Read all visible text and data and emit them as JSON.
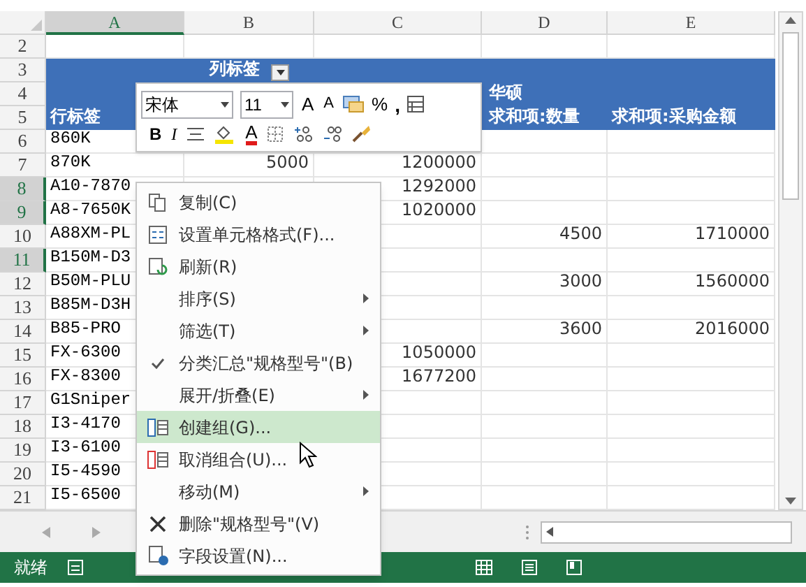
{
  "columns": [
    "A",
    "B",
    "C",
    "D",
    "E"
  ],
  "rows": [
    {
      "num": "2",
      "selected": false,
      "kind": "blank",
      "cells": [
        "",
        "",
        "",
        "",
        ""
      ]
    },
    {
      "num": "3",
      "selected": false,
      "kind": "pivot-header",
      "cells": [
        "",
        "列标签",
        "",
        "",
        ""
      ],
      "dropdown": true
    },
    {
      "num": "4",
      "selected": false,
      "kind": "pivot-header",
      "cells": [
        "",
        "",
        "",
        "华硕",
        ""
      ]
    },
    {
      "num": "5",
      "selected": false,
      "kind": "pivot-header",
      "cells": [
        "行标签",
        "",
        "",
        "求和项:数量",
        "求和项:采购金额"
      ]
    },
    {
      "num": "6",
      "selected": false,
      "kind": "data",
      "cells": [
        "860K",
        "",
        "",
        "",
        ""
      ]
    },
    {
      "num": "7",
      "selected": false,
      "kind": "data",
      "cells": [
        "870K",
        "5000",
        "1200000",
        "",
        ""
      ]
    },
    {
      "num": "8",
      "selected": true,
      "kind": "data",
      "cells": [
        "A10-7870",
        "",
        "1292000",
        "",
        ""
      ]
    },
    {
      "num": "9",
      "selected": true,
      "kind": "data",
      "cells": [
        "A8-7650K",
        "",
        "1020000",
        "",
        ""
      ]
    },
    {
      "num": "10",
      "selected": false,
      "kind": "data",
      "cells": [
        "A88XM-PL",
        "",
        "",
        "4500",
        "1710000"
      ]
    },
    {
      "num": "11",
      "selected": true,
      "kind": "data",
      "cells": [
        "B150M-D3",
        "",
        "",
        "",
        ""
      ]
    },
    {
      "num": "12",
      "selected": false,
      "kind": "data",
      "cells": [
        "B50M-PLU",
        "",
        "",
        "3000",
        "1560000"
      ]
    },
    {
      "num": "13",
      "selected": false,
      "kind": "data",
      "cells": [
        "B85M-D3H",
        "",
        "",
        "",
        ""
      ]
    },
    {
      "num": "14",
      "selected": false,
      "kind": "data",
      "cells": [
        "B85-PRO",
        "",
        "",
        "3600",
        "2016000"
      ]
    },
    {
      "num": "15",
      "selected": false,
      "kind": "data",
      "cells": [
        "FX-6300",
        "",
        "1050000",
        "",
        ""
      ]
    },
    {
      "num": "16",
      "selected": false,
      "kind": "data",
      "cells": [
        "FX-8300",
        "",
        "1677200",
        "",
        ""
      ]
    },
    {
      "num": "17",
      "selected": false,
      "kind": "data",
      "cells": [
        "G1Sniper",
        "",
        "",
        "",
        ""
      ]
    },
    {
      "num": "18",
      "selected": false,
      "kind": "data",
      "cells": [
        "I3-4170",
        "",
        "",
        "",
        ""
      ]
    },
    {
      "num": "19",
      "selected": false,
      "kind": "data",
      "cells": [
        "I3-6100",
        "",
        "",
        "",
        ""
      ]
    },
    {
      "num": "20",
      "selected": false,
      "kind": "data",
      "cells": [
        "I5-4590",
        "",
        "",
        "",
        ""
      ]
    },
    {
      "num": "21",
      "selected": false,
      "kind": "data",
      "cells": [
        "I5-6500",
        "",
        "",
        "",
        ""
      ]
    }
  ],
  "mini_toolbar": {
    "font": "宋体",
    "size": "11",
    "percent": "%",
    "comma": ",",
    "bold": "B",
    "italic": "I",
    "font_color": "A",
    "grow": "A",
    "shrink": "A"
  },
  "context_menu": [
    {
      "label": "复制(C)",
      "kind": "copy",
      "submenu": false,
      "checked": false,
      "selected": false
    },
    {
      "label": "设置单元格格式(F)...",
      "kind": "format",
      "submenu": false,
      "checked": false,
      "selected": false
    },
    {
      "label": "刷新(R)",
      "kind": "refresh",
      "submenu": false,
      "checked": false,
      "selected": false
    },
    {
      "label": "排序(S)",
      "kind": "plain",
      "submenu": true,
      "checked": false,
      "selected": false
    },
    {
      "label": "筛选(T)",
      "kind": "plain",
      "submenu": true,
      "checked": false,
      "selected": false
    },
    {
      "label": "分类汇总\"规格型号\"(B)",
      "kind": "plain",
      "submenu": false,
      "checked": true,
      "selected": false
    },
    {
      "label": "展开/折叠(E)",
      "kind": "plain",
      "submenu": true,
      "checked": false,
      "selected": false
    },
    {
      "label": "创建组(G)...",
      "kind": "group",
      "submenu": false,
      "checked": false,
      "selected": true
    },
    {
      "label": "取消组合(U)...",
      "kind": "ungroup",
      "submenu": false,
      "checked": false,
      "selected": false
    },
    {
      "label": "移动(M)",
      "kind": "plain",
      "submenu": true,
      "checked": false,
      "selected": false
    },
    {
      "label": "删除\"规格型号\"(V)",
      "kind": "delete",
      "submenu": false,
      "checked": false,
      "selected": false
    },
    {
      "label": "字段设置(N)...",
      "kind": "settings",
      "submenu": false,
      "checked": false,
      "selected": false
    }
  ],
  "status_bar": {
    "status": "就绪"
  }
}
